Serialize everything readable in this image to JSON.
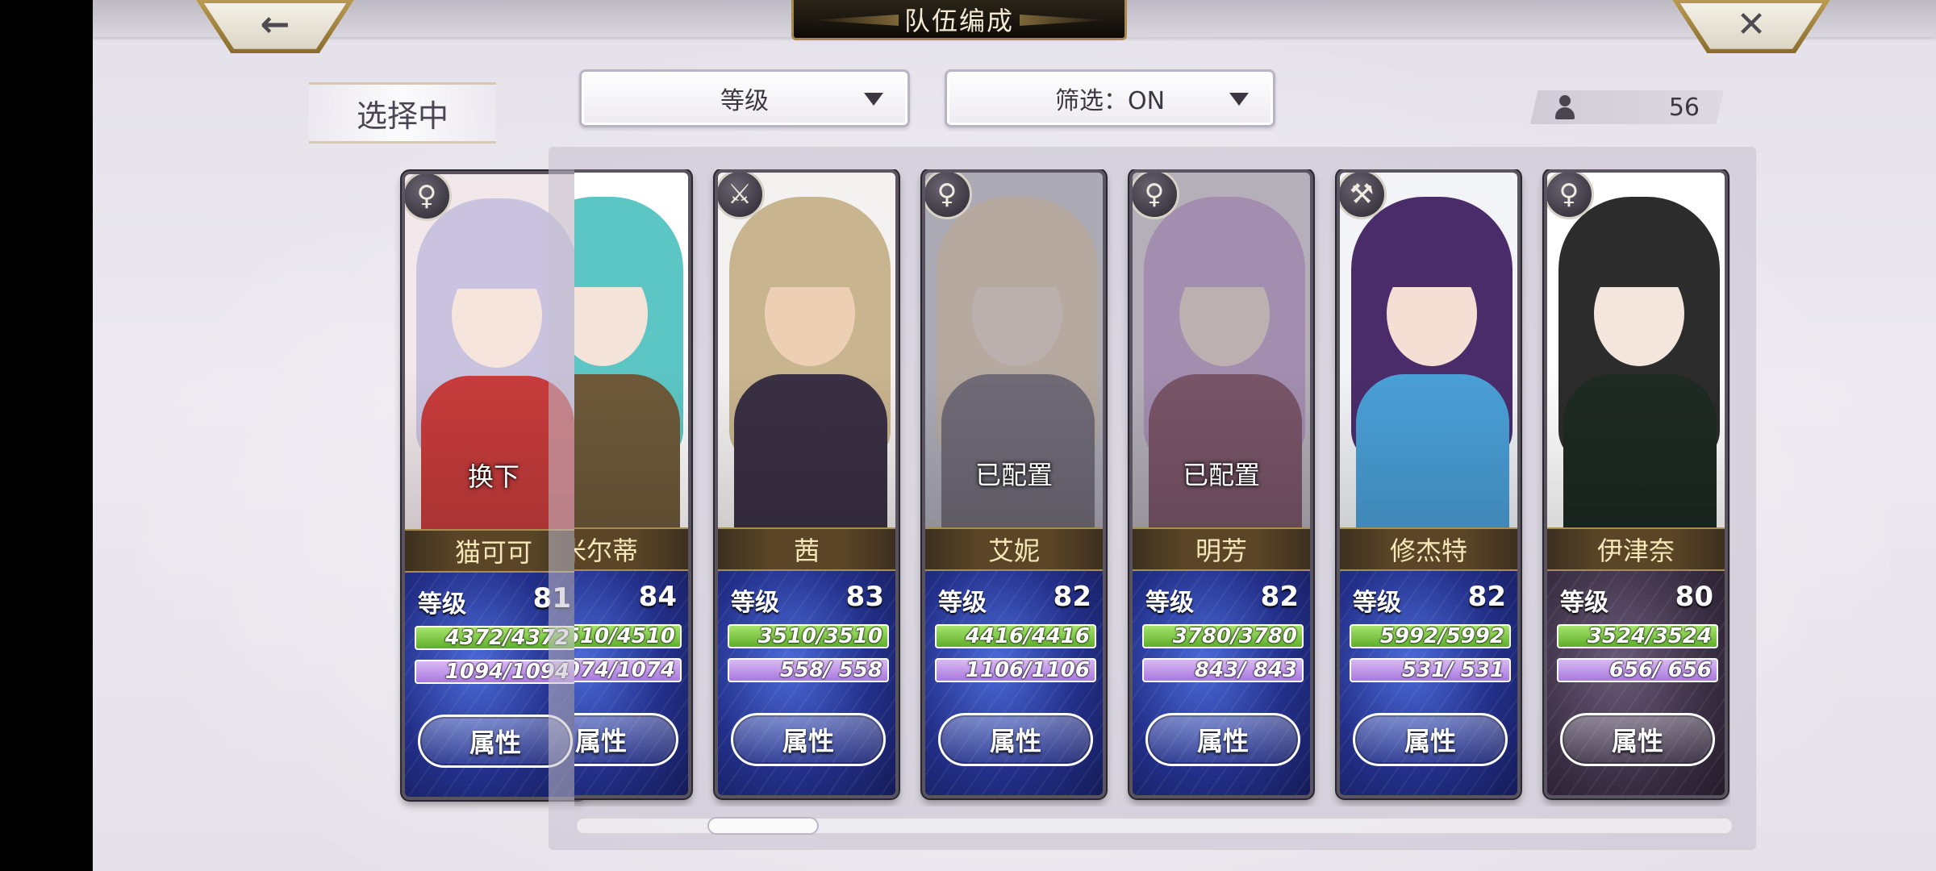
{
  "header": {
    "title": "队伍编成",
    "back_icon": "left-arrow-icon",
    "close_icon": "close-x-icon"
  },
  "selection": {
    "label": "选择中"
  },
  "sort_dropdown": {
    "value": "等级"
  },
  "filter_dropdown": {
    "value": "筛选：ON"
  },
  "member_count": {
    "value": "56",
    "icon": "user-icon"
  },
  "colors": {
    "hp_bar": "#6dbb35",
    "mp_bar": "#b58ae6",
    "name_bar": "#5a4526",
    "stats_bg": "#23308a"
  },
  "selected_card": {
    "name": "猫可可",
    "overlay": "换下",
    "level_label": "等级",
    "level": "81",
    "hp": "4372/4372",
    "mp": "1094/1094",
    "button": "属性",
    "weapon_icon": "staff-icon",
    "hair": "#c9c3e0",
    "skin": "#f6e5dc",
    "outfit": "#c83c3c",
    "bg": "#f2e8ec"
  },
  "characters": [
    {
      "name": "米尔蒂",
      "overlay": "",
      "level_label": "等级",
      "level": "84",
      "hp": "510/4510",
      "mp": "074/1074",
      "button": "属性",
      "weapon_icon": "staff-icon",
      "hair": "#5cc6c4",
      "skin": "#f4e3d8",
      "outfit": "#6e5a3a",
      "bg": "#ffffff",
      "dark": false,
      "dim": false
    },
    {
      "name": "茜",
      "overlay": "",
      "level_label": "等级",
      "level": "83",
      "hp": "3510/3510",
      "mp": "558/ 558",
      "button": "属性",
      "weapon_icon": "sword-icon",
      "hair": "#c8b48e",
      "skin": "#edcfb4",
      "outfit": "#3a3044",
      "bg": "#f4f2f0",
      "dark": false,
      "dim": false
    },
    {
      "name": "艾妮",
      "overlay": "已配置",
      "level_label": "等级",
      "level": "82",
      "hp": "4416/4416",
      "mp": "1106/1106",
      "button": "属性",
      "weapon_icon": "staff-icon",
      "hair": "#e9d8bd",
      "skin": "#f3e2d6",
      "outfit": "#6b6474",
      "bg": "#d8d8e4",
      "dark": false,
      "dim": true
    },
    {
      "name": "明芳",
      "overlay": "已配置",
      "level_label": "等级",
      "level": "82",
      "hp": "3780/3780",
      "mp": "843/ 843",
      "button": "属性",
      "weapon_icon": "staff-icon",
      "hair": "#c6a4da",
      "skin": "#f5e2da",
      "outfit": "#7a3c58",
      "bg": "#e6e0ea",
      "dark": false,
      "dim": true
    },
    {
      "name": "修杰特",
      "overlay": "",
      "level_label": "等级",
      "level": "82",
      "hp": "5992/5992",
      "mp": "531/ 531",
      "button": "属性",
      "weapon_icon": "axe-icon",
      "hair": "#4a2c6a",
      "skin": "#f5dfd4",
      "outfit": "#4aa0d8",
      "bg": "#f2f4f8",
      "dark": false,
      "dim": false
    },
    {
      "name": "伊津奈",
      "overlay": "",
      "level_label": "等级",
      "level": "80",
      "hp": "3524/3524",
      "mp": "656/ 656",
      "button": "属性",
      "weapon_icon": "staff-icon",
      "hair": "#2c2c2c",
      "skin": "#f4e6dc",
      "outfit": "#1e2a24",
      "bg": "#ffffff",
      "dark": true,
      "dim": false
    }
  ]
}
